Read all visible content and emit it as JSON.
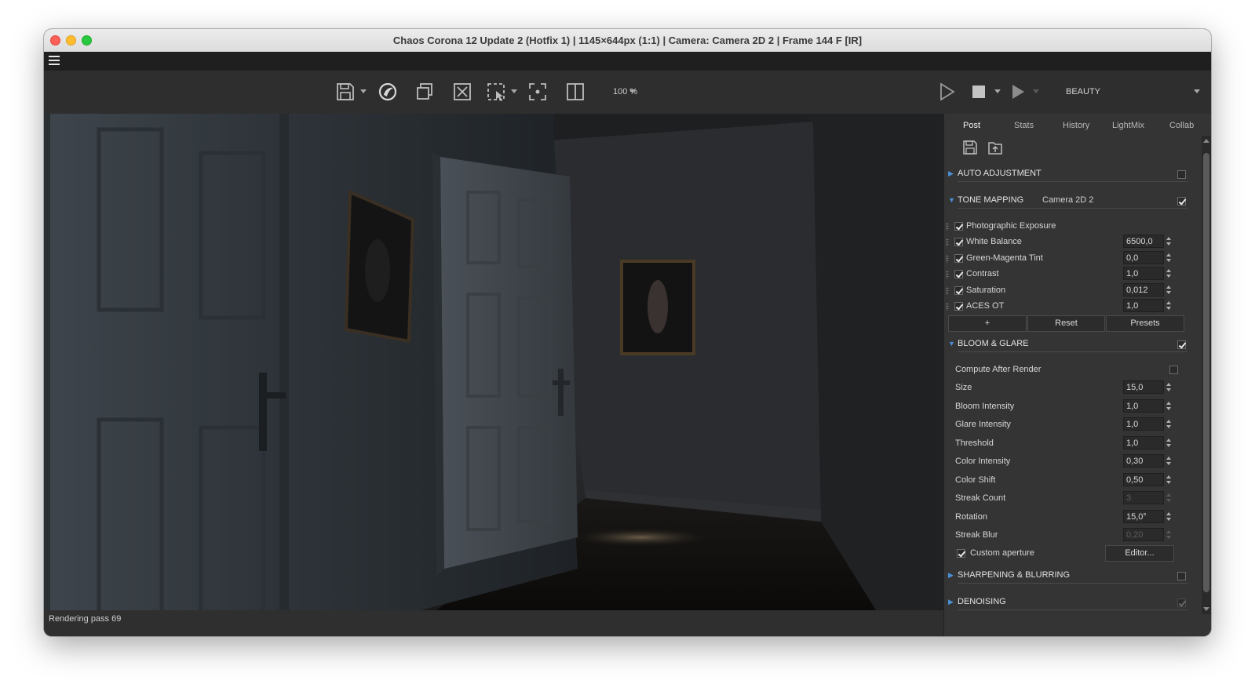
{
  "window": {
    "title": "Chaos Corona 12 Update 2 (Hotfix 1) | 1145×644px (1:1) | Camera: Camera 2D 2 | Frame 144 F [IR]"
  },
  "toolbar": {
    "zoom": "100 %",
    "pass": "BEAUTY",
    "icons": [
      "save-icon",
      "corona-logo-icon",
      "copy-icon",
      "clear-icon",
      "region-select-icon",
      "focus-icon",
      "compare-icon",
      "play-icon",
      "stop-icon",
      "interactive-render-icon"
    ]
  },
  "status": {
    "text": "Rendering pass 69"
  },
  "panel": {
    "tabs": [
      "Post",
      "Stats",
      "History",
      "LightMix",
      "Collab"
    ],
    "active_tab": "Post",
    "sections": {
      "auto_adjustment": {
        "title": "AUTO ADJUSTMENT",
        "enabled": false
      },
      "tone_mapping": {
        "title": "TONE MAPPING",
        "camera": "Camera 2D 2",
        "enabled": true
      },
      "bloom_glare": {
        "title": "BLOOM & GLARE",
        "enabled": true
      },
      "sharpening": {
        "title": "SHARPENING & BLURRING",
        "enabled": false
      },
      "denoising": {
        "title": "DENOISING",
        "enabled": true
      }
    },
    "tone_ops": [
      {
        "label": "Photographic Exposure",
        "checked": true,
        "value": ""
      },
      {
        "label": "White Balance",
        "checked": true,
        "value": "6500,0"
      },
      {
        "label": "Green-Magenta Tint",
        "checked": true,
        "value": "0,0"
      },
      {
        "label": "Contrast",
        "checked": true,
        "value": "1,0"
      },
      {
        "label": "Saturation",
        "checked": true,
        "value": "0,012"
      },
      {
        "label": "ACES OT",
        "checked": true,
        "value": "1,0"
      }
    ],
    "tone_buttons": {
      "add": "+",
      "reset": "Reset",
      "presets": "Presets"
    },
    "bloom": {
      "compute_after_render": "Compute After Render",
      "params": [
        {
          "label": "Size",
          "value": "15,0",
          "disabled": false
        },
        {
          "label": "Bloom Intensity",
          "value": "1,0",
          "disabled": false
        },
        {
          "label": "Glare Intensity",
          "value": "1,0",
          "disabled": false
        },
        {
          "label": "Threshold",
          "value": "1,0",
          "disabled": false
        },
        {
          "label": "Color Intensity",
          "value": "0,30",
          "disabled": false
        },
        {
          "label": "Color Shift",
          "value": "0,50",
          "disabled": false
        },
        {
          "label": "Streak Count",
          "value": "3",
          "disabled": true
        },
        {
          "label": "Rotation",
          "value": "15,0°",
          "disabled": false
        },
        {
          "label": "Streak Blur",
          "value": "0,20",
          "disabled": true
        }
      ],
      "custom_aperture": "Custom aperture",
      "editor_button": "Editor..."
    }
  },
  "colors": {
    "accent": "#4a8fd8",
    "panel_bg": "#343434",
    "toolbar_bg": "#2e2e2e"
  }
}
